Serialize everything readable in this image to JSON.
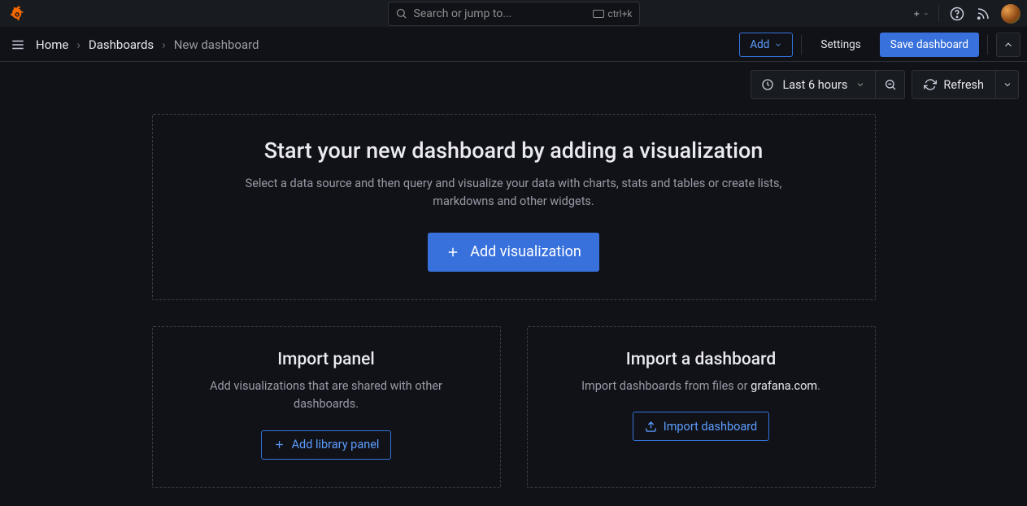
{
  "search": {
    "placeholder": "Search or jump to...",
    "shortcut": "ctrl+k"
  },
  "breadcrumb": {
    "home": "Home",
    "dashboards": "Dashboards",
    "current": "New dashboard"
  },
  "actions": {
    "add": "Add",
    "settings": "Settings",
    "save": "Save dashboard"
  },
  "timepicker": {
    "range": "Last 6 hours",
    "refresh": "Refresh"
  },
  "hero": {
    "title": "Start your new dashboard by adding a visualization",
    "subtitle": "Select a data source and then query and visualize your data with charts, stats and tables or create lists, markdowns and other widgets.",
    "button": "Add visualization"
  },
  "import_panel": {
    "title": "Import panel",
    "subtitle": "Add visualizations that are shared with other dashboards.",
    "button": "Add library panel"
  },
  "import_dashboard": {
    "title": "Import a dashboard",
    "subtitle_prefix": "Import dashboards from files or ",
    "subtitle_link": "grafana.com",
    "subtitle_suffix": ".",
    "button": "Import dashboard"
  }
}
